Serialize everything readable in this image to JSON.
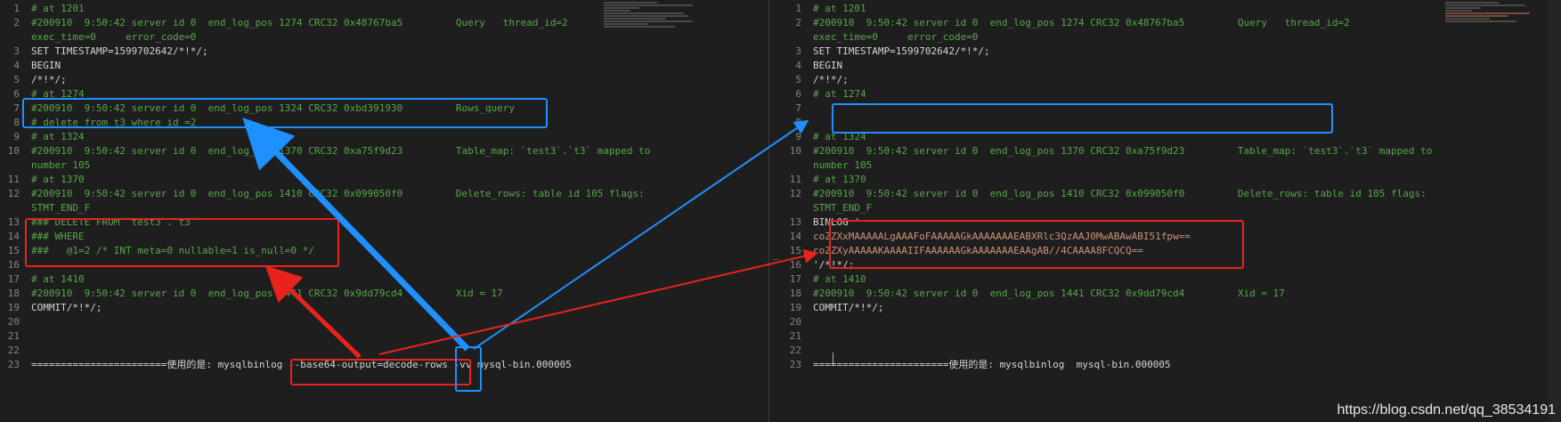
{
  "left_pane": {
    "lines": [
      {
        "n": "1",
        "segments": [
          {
            "t": "# at 1201",
            "c": "c"
          }
        ]
      },
      {
        "n": "2",
        "segments": [
          {
            "t": "#200910  9:50:42 server id 0  end_log_pos 1274 CRC32 0x48767ba5         Query   thread_id=2",
            "c": "c"
          }
        ]
      },
      {
        "n": "",
        "segments": [
          {
            "t": "exec_time=0     error_code=0",
            "c": "c"
          }
        ]
      },
      {
        "n": "3",
        "segments": [
          {
            "t": "SET TIMESTAMP=1599702642/*!*/;",
            "c": "w"
          }
        ]
      },
      {
        "n": "4",
        "segments": [
          {
            "t": "BEGIN",
            "c": "w"
          }
        ]
      },
      {
        "n": "5",
        "segments": [
          {
            "t": "/*!*/;",
            "c": "w"
          }
        ]
      },
      {
        "n": "6",
        "segments": [
          {
            "t": "# at 1274",
            "c": "c"
          }
        ]
      },
      {
        "n": "7",
        "segments": [
          {
            "t": "#200910  9:50:42 server id 0  end_log_pos 1324 CRC32 0xbd391930         Rows_query",
            "c": "c"
          }
        ]
      },
      {
        "n": "8",
        "segments": [
          {
            "t": "# delete from t3 where id =2",
            "c": "c"
          }
        ]
      },
      {
        "n": "9",
        "segments": [
          {
            "t": "# at 1324",
            "c": "c"
          }
        ]
      },
      {
        "n": "10",
        "segments": [
          {
            "t": "#200910  9:50:42 server id 0  end_log_pos 1370 CRC32 0xa75f9d23         Table_map: `test3`.`t3` mapped to",
            "c": "c"
          }
        ]
      },
      {
        "n": "",
        "segments": [
          {
            "t": "number 105",
            "c": "c"
          }
        ]
      },
      {
        "n": "11",
        "segments": [
          {
            "t": "# at 1370",
            "c": "c"
          }
        ]
      },
      {
        "n": "12",
        "segments": [
          {
            "t": "#200910  9:50:42 server id 0  end_log_pos 1410 CRC32 0x099050f0         Delete_rows: table id 105 flags:",
            "c": "c"
          }
        ]
      },
      {
        "n": "",
        "segments": [
          {
            "t": "STMT_END_F",
            "c": "c"
          }
        ]
      },
      {
        "n": "13",
        "segments": [
          {
            "t": "### DELETE FROM `test3`.`t3`",
            "c": "c"
          }
        ]
      },
      {
        "n": "14",
        "segments": [
          {
            "t": "### WHERE",
            "c": "c"
          }
        ]
      },
      {
        "n": "15",
        "segments": [
          {
            "t": "###   @1=2 /* INT meta=0 nullable=1 is_null=0 */",
            "c": "c"
          }
        ]
      },
      {
        "n": "16",
        "segments": [
          {
            "t": "",
            "c": "w"
          }
        ]
      },
      {
        "n": "17",
        "segments": [
          {
            "t": "# at 1410",
            "c": "c"
          }
        ]
      },
      {
        "n": "18",
        "segments": [
          {
            "t": "#200910  9:50:42 server id 0  end_log_pos 1441 CRC32 0x9dd79cd4         Xid = 17",
            "c": "c"
          }
        ]
      },
      {
        "n": "19",
        "segments": [
          {
            "t": "COMMIT/*!*/;",
            "c": "w"
          }
        ]
      },
      {
        "n": "20",
        "segments": [
          {
            "t": "",
            "c": "w"
          }
        ]
      },
      {
        "n": "21",
        "segments": [
          {
            "t": "",
            "c": "w"
          }
        ]
      },
      {
        "n": "22",
        "segments": [
          {
            "t": "",
            "c": "w"
          }
        ]
      },
      {
        "n": "23",
        "segments": [
          {
            "t": "=======================使用的是: mysqlbinlog --base64-output=decode-rows -vv mysql-bin.000005",
            "c": "w"
          }
        ]
      }
    ]
  },
  "right_pane": {
    "lines": [
      {
        "n": "1",
        "segments": [
          {
            "t": "# at 1201",
            "c": "c"
          }
        ]
      },
      {
        "n": "2",
        "segments": [
          {
            "t": "#200910  9:50:42 server id 0  end_log_pos 1274 CRC32 0x48767ba5         Query   thread_id=2",
            "c": "c"
          }
        ]
      },
      {
        "n": "",
        "segments": [
          {
            "t": "exec_time=0     error_code=0",
            "c": "c"
          }
        ]
      },
      {
        "n": "3",
        "segments": [
          {
            "t": "SET TIMESTAMP=1599702642/*!*/;",
            "c": "w"
          }
        ]
      },
      {
        "n": "4",
        "segments": [
          {
            "t": "BEGIN",
            "c": "w"
          }
        ]
      },
      {
        "n": "5",
        "segments": [
          {
            "t": "/*!*/;",
            "c": "w"
          }
        ]
      },
      {
        "n": "6",
        "segments": [
          {
            "t": "# at 1274",
            "c": "c"
          }
        ]
      },
      {
        "n": "7",
        "segments": [
          {
            "t": "",
            "c": "w"
          }
        ]
      },
      {
        "n": "8",
        "segments": [
          {
            "t": "",
            "c": "w"
          }
        ]
      },
      {
        "n": "9",
        "segments": [
          {
            "t": "# at 1324",
            "c": "c"
          }
        ]
      },
      {
        "n": "10",
        "segments": [
          {
            "t": "#200910  9:50:42 server id 0  end_log_pos 1370 CRC32 0xa75f9d23         Table_map: `test3`.`t3` mapped to",
            "c": "c"
          }
        ]
      },
      {
        "n": "",
        "segments": [
          {
            "t": "number 105",
            "c": "c"
          }
        ]
      },
      {
        "n": "11",
        "segments": [
          {
            "t": "# at 1370",
            "c": "c"
          }
        ]
      },
      {
        "n": "12",
        "segments": [
          {
            "t": "#200910  9:50:42 server id 0  end_log_pos 1410 CRC32 0x099050f0         Delete_rows: table id 105 flags:",
            "c": "c"
          }
        ]
      },
      {
        "n": "",
        "segments": [
          {
            "t": "STMT_END_F",
            "c": "c"
          }
        ]
      },
      {
        "n": "13",
        "segments": [
          {
            "t": "BINLOG '",
            "c": "w"
          }
        ]
      },
      {
        "n": "14",
        "segments": [
          {
            "t": "coZZXxMAAAAALgAAAFoFAAAAAGkAAAAAAAEABXRlc3QzAAJ0MwABAwABI51fpw==",
            "c": "o"
          }
        ]
      },
      {
        "n": "15",
        "segments": [
          {
            "t": "coZZXyAAAAAKAAAAIIFAAAAAAGkAAAAAAAEAAgAB//4CAAAA8FCQCQ==",
            "c": "o"
          }
        ]
      },
      {
        "n": "16",
        "segments": [
          {
            "t": "'/*!*/;",
            "c": "w"
          }
        ]
      },
      {
        "n": "17",
        "segments": [
          {
            "t": "# at 1410",
            "c": "c"
          }
        ]
      },
      {
        "n": "18",
        "segments": [
          {
            "t": "#200910  9:50:42 server id 0  end_log_pos 1441 CRC32 0x9dd79cd4         Xid = 17",
            "c": "c"
          }
        ]
      },
      {
        "n": "19",
        "segments": [
          {
            "t": "COMMIT/*!*/;",
            "c": "w"
          }
        ]
      },
      {
        "n": "20",
        "segments": [
          {
            "t": "",
            "c": "w"
          }
        ]
      },
      {
        "n": "21",
        "segments": [
          {
            "t": "",
            "c": "w"
          }
        ]
      },
      {
        "n": "22",
        "segments": [
          {
            "t": "",
            "c": "w"
          }
        ]
      },
      {
        "n": "23",
        "segments": [
          {
            "t": "=======================使用的是: mysqlbinlog  mysql-bin.000005",
            "c": "w"
          }
        ]
      }
    ]
  },
  "watermark": "https://blog.csdn.net/qq_38534191",
  "colors": {
    "background": "#1e1e1e",
    "comment": "#57a64a",
    "plain": "#d4d4d4",
    "string": "#ce9178",
    "line_number": "#858585",
    "annotation_blue": "#1e90ff",
    "annotation_red": "#e8231e"
  }
}
